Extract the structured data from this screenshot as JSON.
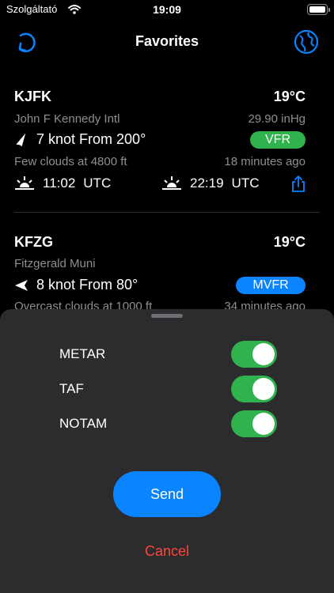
{
  "status_bar": {
    "carrier": "Szolgáltató",
    "time": "19:09"
  },
  "nav": {
    "title": "Favorites",
    "left_icon": "refresh-icon",
    "right_icon": "globe-icon"
  },
  "favorites": [
    {
      "station": "KJFK",
      "temperature": "19°C",
      "name": "John F Kennedy Intl",
      "pressure": "29.90 inHg",
      "wind": "7 knot From 200°",
      "category": "VFR",
      "category_color": "#30b34c",
      "clouds": "Few clouds at 4800 ft",
      "age": "18 minutes ago",
      "sunrise": "11:02",
      "sunrise_tz": "UTC",
      "sunset": "22:19",
      "sunset_tz": "UTC"
    },
    {
      "station": "KFZG",
      "temperature": "19°C",
      "name": "Fitzgerald Muni",
      "wind": "8 knot From 80°",
      "category": "MVFR",
      "category_color": "#0a84ff",
      "clouds": "Overcast clouds at 1000 ft",
      "age": "34 minutes ago"
    }
  ],
  "sheet": {
    "options": [
      {
        "label": "METAR",
        "enabled": true
      },
      {
        "label": "TAF",
        "enabled": true
      },
      {
        "label": "NOTAM",
        "enabled": true
      }
    ],
    "send_label": "Send",
    "cancel_label": "Cancel"
  },
  "colors": {
    "accent": "#0a84ff",
    "toggle_on": "#30b34c",
    "destructive": "#ff453a"
  }
}
